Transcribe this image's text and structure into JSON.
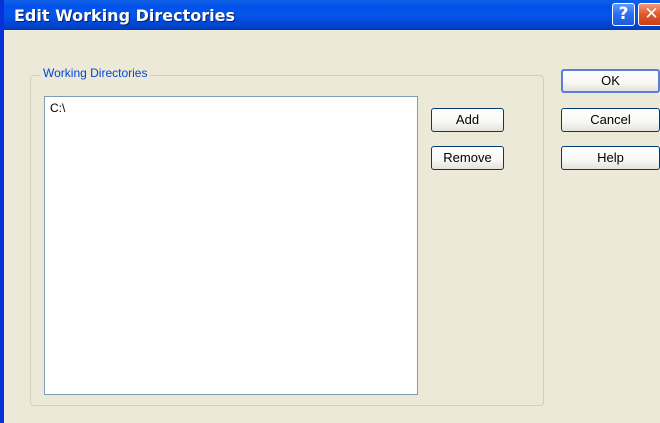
{
  "window": {
    "title": "Edit Working Directories",
    "help_glyph": "?",
    "close_glyph": "✕"
  },
  "group": {
    "label": "Working Directories"
  },
  "directories": {
    "items": [
      "C:\\"
    ]
  },
  "buttons": {
    "add": "Add",
    "remove": "Remove",
    "ok": "OK",
    "cancel": "Cancel",
    "help": "Help"
  },
  "colors": {
    "titlebar": "#0556e8",
    "group_label": "#0046d5",
    "face": "#ece9d8"
  }
}
